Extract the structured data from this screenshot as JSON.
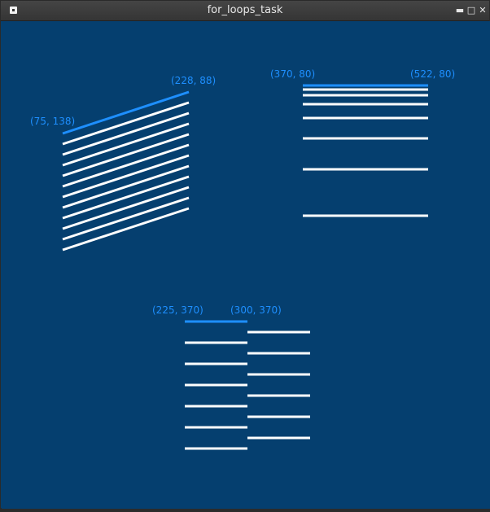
{
  "window": {
    "title": "for_loops_task",
    "minimize_glyph": "▬",
    "maximize_glyph": "□",
    "close_glyph": "✕",
    "app_icon": "window-icon",
    "background_color": "#053f6f",
    "highlight_color": "#1e8fff",
    "line_color": "#ffffff"
  },
  "labels": {
    "fan_start": "(75, 138)",
    "fan_end": "(228, 88)",
    "comb_start": "(370, 80)",
    "comb_end": "(522, 80)",
    "stairs_left": "(225, 370)",
    "stairs_right": "(300, 370)"
  }
}
